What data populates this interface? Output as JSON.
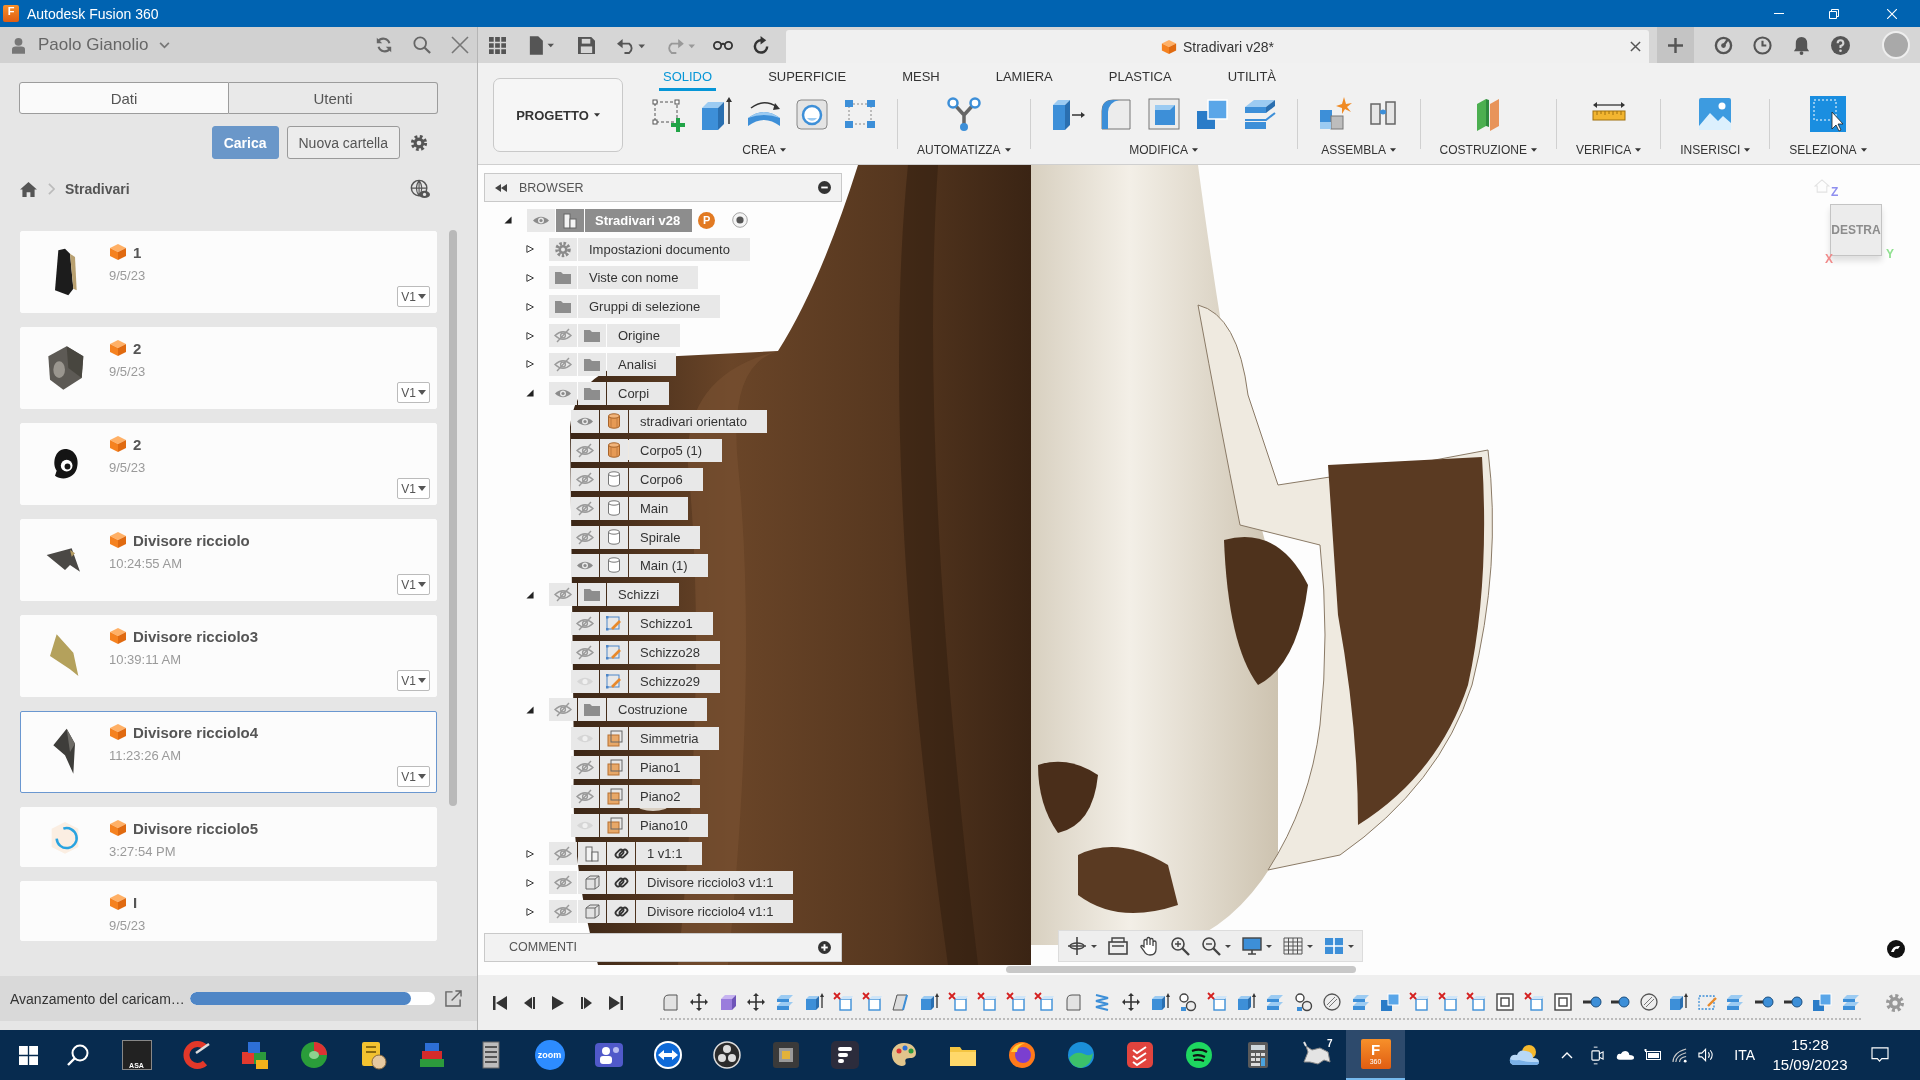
{
  "window": {
    "logo": "F",
    "title": "Autodesk Fusion 360"
  },
  "data_panel": {
    "user": "Paolo Gianolio",
    "tabs": [
      {
        "label": "Dati",
        "selected": true
      },
      {
        "label": "Utenti",
        "selected": false
      }
    ],
    "buttons": [
      {
        "label": "Carica",
        "kind": "primary"
      },
      {
        "label": "Nuova cartella",
        "kind": "secondary"
      }
    ],
    "breadcrumb": [
      "Stradivari"
    ],
    "files": [
      {
        "name": "1",
        "date": "9/5/23",
        "version": "V1",
        "kind": "model",
        "selected": false
      },
      {
        "name": "2",
        "date": "9/5/23",
        "version": "V1",
        "kind": "model",
        "selected": false
      },
      {
        "name": "2",
        "date": "9/5/23",
        "version": "V1",
        "kind": "model",
        "selected": false
      },
      {
        "name": "Divisore ricciolo",
        "date": "10:24:55 AM",
        "version": "V1",
        "kind": "model",
        "selected": false
      },
      {
        "name": "Divisore ricciolo3",
        "date": "10:39:11 AM",
        "version": "V1",
        "kind": "model",
        "selected": false
      },
      {
        "name": "Divisore ricciolo4",
        "date": "11:23:26 AM",
        "version": "V1",
        "kind": "model",
        "selected": true
      },
      {
        "name": "Divisore ricciolo5",
        "date": "3:27:54 PM",
        "kind": "loading",
        "selected": false
      },
      {
        "name": "I",
        "date": "9/5/23",
        "kind": "blank",
        "selected": false
      }
    ],
    "upload": {
      "label": "Avanzamento del caricam…",
      "level": 0.9
    }
  },
  "document": {
    "title": "Stradivari v28*"
  },
  "ribbon": {
    "workspace": "PROGETTO",
    "tabs": [
      {
        "label": "SOLIDO",
        "selected": true
      },
      {
        "label": "SUPERFICIE",
        "selected": false
      },
      {
        "label": "MESH",
        "selected": false
      },
      {
        "label": "LAMIERA",
        "selected": false
      },
      {
        "label": "PLASTICA",
        "selected": false
      },
      {
        "label": "UTILITÀ",
        "selected": false
      }
    ],
    "groups": [
      {
        "label": "CREA"
      },
      {
        "label": "AUTOMATIZZA"
      },
      {
        "label": "MODIFICA"
      },
      {
        "label": "ASSEMBLA"
      },
      {
        "label": "COSTRUZIONE"
      },
      {
        "label": "VERIFICA"
      },
      {
        "label": "INSERISCI"
      },
      {
        "label": "SELEZIONA"
      }
    ]
  },
  "browser": {
    "title": "BROWSER",
    "tree": [
      {
        "label": "Stradivari v28",
        "kind": "component",
        "visible": true,
        "expanded": true,
        "active": true,
        "badge": "P",
        "children": [
          {
            "label": "Impostazioni documento",
            "kind": "settings",
            "expanded": false
          },
          {
            "label": "Viste con nome",
            "kind": "folder",
            "expanded": false
          },
          {
            "label": "Gruppi di selezione",
            "kind": "folder",
            "expanded": false
          },
          {
            "label": "Origine",
            "kind": "folder",
            "visible": false,
            "expanded": false
          },
          {
            "label": "Analisi",
            "kind": "folder",
            "visible": false,
            "expanded": false
          },
          {
            "label": "Corpi",
            "kind": "folder",
            "visible": true,
            "expanded": true,
            "children": [
              {
                "label": "stradivari orientato",
                "kind": "mesh_body",
                "visible": true
              },
              {
                "label": "Corpo5 (1)",
                "kind": "mesh_body",
                "visible": false
              },
              {
                "label": "Corpo6",
                "kind": "body",
                "visible": false
              },
              {
                "label": "Main",
                "kind": "body",
                "visible": false
              },
              {
                "label": "Spirale",
                "kind": "body",
                "visible": false
              },
              {
                "label": "Main (1)",
                "kind": "body",
                "visible": true
              }
            ]
          },
          {
            "label": "Schizzi",
            "kind": "folder",
            "visible": false,
            "expanded": true,
            "children": [
              {
                "label": "Schizzo1",
                "kind": "sketch",
                "visible": false
              },
              {
                "label": "Schizzo28",
                "kind": "sketch",
                "visible": false
              },
              {
                "label": "Schizzo29",
                "kind": "sketch",
                "visible": true
              }
            ]
          },
          {
            "label": "Costruzione",
            "kind": "folder",
            "visible": false,
            "expanded": true,
            "children": [
              {
                "label": "Simmetria",
                "kind": "plane",
                "visible": true
              },
              {
                "label": "Piano1",
                "kind": "plane",
                "visible": false
              },
              {
                "label": "Piano2",
                "kind": "plane",
                "visible": false
              },
              {
                "label": "Piano10",
                "kind": "plane",
                "visible": true
              }
            ]
          },
          {
            "label": "1 v1:1",
            "kind": "component_link",
            "visible": false,
            "expanded": false
          },
          {
            "label": "Divisore ricciolo3 v1:1",
            "kind": "body_link",
            "visible": false,
            "expanded": false
          },
          {
            "label": "Divisore ricciolo4 v1:1",
            "kind": "body_link",
            "visible": false,
            "expanded": false
          }
        ]
      }
    ],
    "comments": "COMMENTI"
  },
  "view_cube": {
    "face": "DESTRA",
    "axes": [
      "Z",
      "Y",
      "X"
    ]
  },
  "taskbar": {
    "apps": [
      {
        "active": false,
        "label": "ASA"
      },
      {
        "active": false
      },
      {
        "active": false
      },
      {
        "active": false
      },
      {
        "active": false
      },
      {
        "active": false
      },
      {
        "active": false
      },
      {
        "active": false,
        "label": "zoom"
      },
      {
        "active": false
      },
      {
        "active": false
      },
      {
        "active": false
      },
      {
        "active": false
      },
      {
        "active": false
      },
      {
        "active": false
      },
      {
        "active": false
      },
      {
        "active": false
      },
      {
        "active": false
      },
      {
        "active": false
      },
      {
        "active": false
      },
      {
        "active": false
      },
      {
        "active": false,
        "label": "7"
      },
      {
        "active": true,
        "label": "F",
        "sublabel": "360"
      }
    ],
    "language": "ITA",
    "time": "15:28",
    "date": "15/09/2023"
  }
}
